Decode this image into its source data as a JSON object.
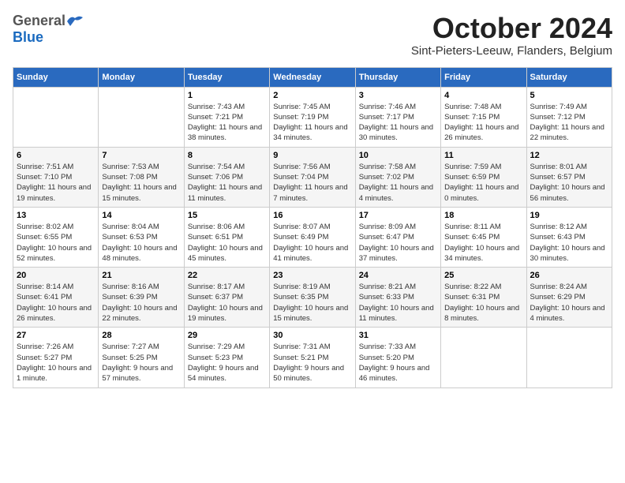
{
  "header": {
    "logo_general": "General",
    "logo_blue": "Blue",
    "month_title": "October 2024",
    "location": "Sint-Pieters-Leeuw, Flanders, Belgium"
  },
  "days_of_week": [
    "Sunday",
    "Monday",
    "Tuesday",
    "Wednesday",
    "Thursday",
    "Friday",
    "Saturday"
  ],
  "weeks": [
    [
      {
        "day": "",
        "sunrise": "",
        "sunset": "",
        "daylight": ""
      },
      {
        "day": "",
        "sunrise": "",
        "sunset": "",
        "daylight": ""
      },
      {
        "day": "1",
        "sunrise": "Sunrise: 7:43 AM",
        "sunset": "Sunset: 7:21 PM",
        "daylight": "Daylight: 11 hours and 38 minutes."
      },
      {
        "day": "2",
        "sunrise": "Sunrise: 7:45 AM",
        "sunset": "Sunset: 7:19 PM",
        "daylight": "Daylight: 11 hours and 34 minutes."
      },
      {
        "day": "3",
        "sunrise": "Sunrise: 7:46 AM",
        "sunset": "Sunset: 7:17 PM",
        "daylight": "Daylight: 11 hours and 30 minutes."
      },
      {
        "day": "4",
        "sunrise": "Sunrise: 7:48 AM",
        "sunset": "Sunset: 7:15 PM",
        "daylight": "Daylight: 11 hours and 26 minutes."
      },
      {
        "day": "5",
        "sunrise": "Sunrise: 7:49 AM",
        "sunset": "Sunset: 7:12 PM",
        "daylight": "Daylight: 11 hours and 22 minutes."
      }
    ],
    [
      {
        "day": "6",
        "sunrise": "Sunrise: 7:51 AM",
        "sunset": "Sunset: 7:10 PM",
        "daylight": "Daylight: 11 hours and 19 minutes."
      },
      {
        "day": "7",
        "sunrise": "Sunrise: 7:53 AM",
        "sunset": "Sunset: 7:08 PM",
        "daylight": "Daylight: 11 hours and 15 minutes."
      },
      {
        "day": "8",
        "sunrise": "Sunrise: 7:54 AM",
        "sunset": "Sunset: 7:06 PM",
        "daylight": "Daylight: 11 hours and 11 minutes."
      },
      {
        "day": "9",
        "sunrise": "Sunrise: 7:56 AM",
        "sunset": "Sunset: 7:04 PM",
        "daylight": "Daylight: 11 hours and 7 minutes."
      },
      {
        "day": "10",
        "sunrise": "Sunrise: 7:58 AM",
        "sunset": "Sunset: 7:02 PM",
        "daylight": "Daylight: 11 hours and 4 minutes."
      },
      {
        "day": "11",
        "sunrise": "Sunrise: 7:59 AM",
        "sunset": "Sunset: 6:59 PM",
        "daylight": "Daylight: 11 hours and 0 minutes."
      },
      {
        "day": "12",
        "sunrise": "Sunrise: 8:01 AM",
        "sunset": "Sunset: 6:57 PM",
        "daylight": "Daylight: 10 hours and 56 minutes."
      }
    ],
    [
      {
        "day": "13",
        "sunrise": "Sunrise: 8:02 AM",
        "sunset": "Sunset: 6:55 PM",
        "daylight": "Daylight: 10 hours and 52 minutes."
      },
      {
        "day": "14",
        "sunrise": "Sunrise: 8:04 AM",
        "sunset": "Sunset: 6:53 PM",
        "daylight": "Daylight: 10 hours and 48 minutes."
      },
      {
        "day": "15",
        "sunrise": "Sunrise: 8:06 AM",
        "sunset": "Sunset: 6:51 PM",
        "daylight": "Daylight: 10 hours and 45 minutes."
      },
      {
        "day": "16",
        "sunrise": "Sunrise: 8:07 AM",
        "sunset": "Sunset: 6:49 PM",
        "daylight": "Daylight: 10 hours and 41 minutes."
      },
      {
        "day": "17",
        "sunrise": "Sunrise: 8:09 AM",
        "sunset": "Sunset: 6:47 PM",
        "daylight": "Daylight: 10 hours and 37 minutes."
      },
      {
        "day": "18",
        "sunrise": "Sunrise: 8:11 AM",
        "sunset": "Sunset: 6:45 PM",
        "daylight": "Daylight: 10 hours and 34 minutes."
      },
      {
        "day": "19",
        "sunrise": "Sunrise: 8:12 AM",
        "sunset": "Sunset: 6:43 PM",
        "daylight": "Daylight: 10 hours and 30 minutes."
      }
    ],
    [
      {
        "day": "20",
        "sunrise": "Sunrise: 8:14 AM",
        "sunset": "Sunset: 6:41 PM",
        "daylight": "Daylight: 10 hours and 26 minutes."
      },
      {
        "day": "21",
        "sunrise": "Sunrise: 8:16 AM",
        "sunset": "Sunset: 6:39 PM",
        "daylight": "Daylight: 10 hours and 22 minutes."
      },
      {
        "day": "22",
        "sunrise": "Sunrise: 8:17 AM",
        "sunset": "Sunset: 6:37 PM",
        "daylight": "Daylight: 10 hours and 19 minutes."
      },
      {
        "day": "23",
        "sunrise": "Sunrise: 8:19 AM",
        "sunset": "Sunset: 6:35 PM",
        "daylight": "Daylight: 10 hours and 15 minutes."
      },
      {
        "day": "24",
        "sunrise": "Sunrise: 8:21 AM",
        "sunset": "Sunset: 6:33 PM",
        "daylight": "Daylight: 10 hours and 11 minutes."
      },
      {
        "day": "25",
        "sunrise": "Sunrise: 8:22 AM",
        "sunset": "Sunset: 6:31 PM",
        "daylight": "Daylight: 10 hours and 8 minutes."
      },
      {
        "day": "26",
        "sunrise": "Sunrise: 8:24 AM",
        "sunset": "Sunset: 6:29 PM",
        "daylight": "Daylight: 10 hours and 4 minutes."
      }
    ],
    [
      {
        "day": "27",
        "sunrise": "Sunrise: 7:26 AM",
        "sunset": "Sunset: 5:27 PM",
        "daylight": "Daylight: 10 hours and 1 minute."
      },
      {
        "day": "28",
        "sunrise": "Sunrise: 7:27 AM",
        "sunset": "Sunset: 5:25 PM",
        "daylight": "Daylight: 9 hours and 57 minutes."
      },
      {
        "day": "29",
        "sunrise": "Sunrise: 7:29 AM",
        "sunset": "Sunset: 5:23 PM",
        "daylight": "Daylight: 9 hours and 54 minutes."
      },
      {
        "day": "30",
        "sunrise": "Sunrise: 7:31 AM",
        "sunset": "Sunset: 5:21 PM",
        "daylight": "Daylight: 9 hours and 50 minutes."
      },
      {
        "day": "31",
        "sunrise": "Sunrise: 7:33 AM",
        "sunset": "Sunset: 5:20 PM",
        "daylight": "Daylight: 9 hours and 46 minutes."
      },
      {
        "day": "",
        "sunrise": "",
        "sunset": "",
        "daylight": ""
      },
      {
        "day": "",
        "sunrise": "",
        "sunset": "",
        "daylight": ""
      }
    ]
  ]
}
